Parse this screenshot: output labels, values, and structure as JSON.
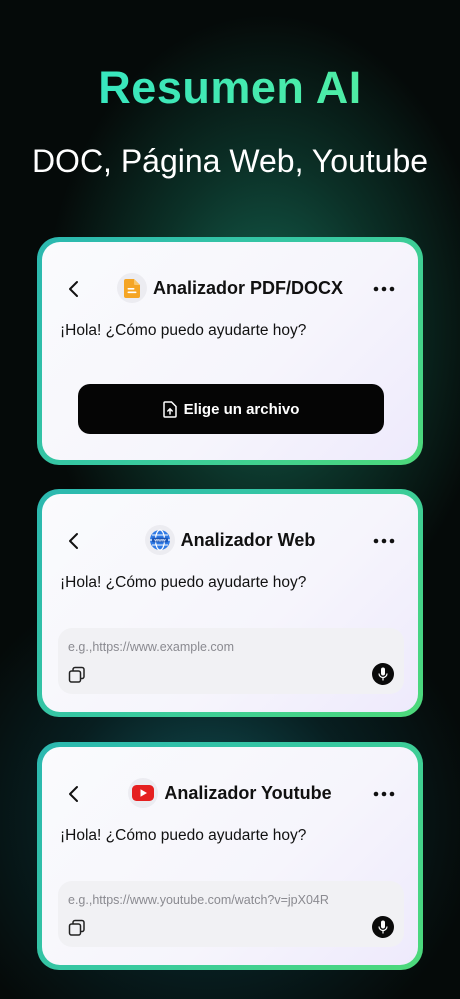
{
  "header": {
    "title": "Resumen AI",
    "subtitle": "DOC, Página Web, Youtube"
  },
  "cards": [
    {
      "title": "Analizador PDF/DOCX",
      "icon": "document-icon",
      "greeting": "¡Hola! ¿Cómo puedo ayudarte hoy?",
      "button_label": "Elige un archivo"
    },
    {
      "title": "Analizador Web",
      "icon": "globe-icon",
      "greeting": "¡Hola! ¿Cómo puedo ayudarte hoy?",
      "placeholder": "e.g.,https://www.example.com"
    },
    {
      "title": "Analizador Youtube",
      "icon": "youtube-icon",
      "greeting": "¡Hola! ¿Cómo puedo ayudarte hoy?",
      "placeholder": "e.g.,https://www.youtube.com/watch?v=jpX04R"
    }
  ],
  "colors": {
    "accent_start": "#2fe3c8",
    "accent_end": "#57f09a",
    "button_bg": "#050505",
    "pdf_icon": "#f5a524",
    "youtube_red": "#e52020",
    "globe_blue": "#2f7ae5"
  }
}
